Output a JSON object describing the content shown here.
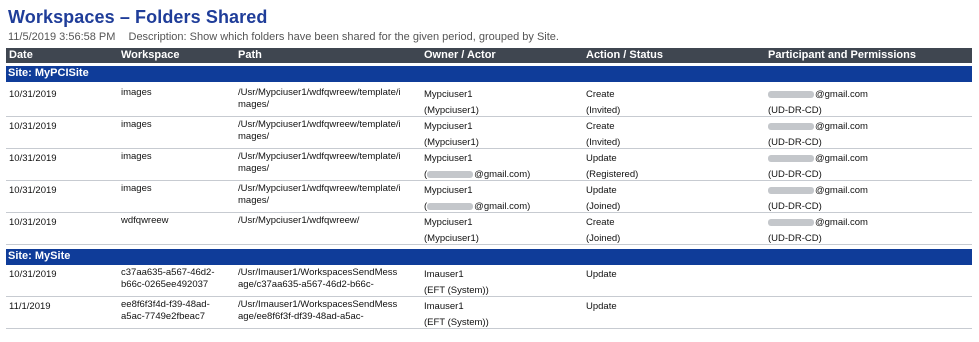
{
  "report": {
    "title": "Workspaces – Folders Shared",
    "timestamp": "11/5/2019 3:56:58 PM",
    "description": "Description: Show which folders have been shared for the given period, grouped  by Site."
  },
  "columns": [
    "Date",
    "Workspace",
    "Path",
    "Owner / Actor",
    "Action / Status",
    "Participant and Permissions"
  ],
  "groups": [
    {
      "site_label": "Site: MyPCISite",
      "rows": [
        {
          "date": "10/31/2019",
          "workspace": [
            "images"
          ],
          "path": [
            "/Usr/Mypciuser1/wdfqwreew/template/i",
            "mages/"
          ],
          "owner": [
            "Mypciuser1",
            "(Mypciuser1)"
          ],
          "action": [
            "Create",
            "(Invited)"
          ],
          "participant": [
            "@gmail.com",
            "(UD-DR-CD)"
          ]
        },
        {
          "date": "10/31/2019",
          "workspace": [
            "images"
          ],
          "path": [
            "/Usr/Mypciuser1/wdfqwreew/template/i",
            "mages/"
          ],
          "owner": [
            "Mypciuser1",
            "(Mypciuser1)"
          ],
          "action": [
            "Create",
            "(Invited)"
          ],
          "participant": [
            "@gmail.com",
            "(UD-DR-CD)"
          ]
        },
        {
          "date": "10/31/2019",
          "workspace": [
            "images"
          ],
          "path": [
            "/Usr/Mypciuser1/wdfqwreew/template/i",
            "mages/"
          ],
          "owner": [
            "Mypciuser1",
            "@gmail.com)"
          ],
          "action": [
            "Update",
            "(Registered)"
          ],
          "participant": [
            "@gmail.com",
            "(UD-DR-CD)"
          ]
        },
        {
          "date": "10/31/2019",
          "workspace": [
            "images"
          ],
          "path": [
            "/Usr/Mypciuser1/wdfqwreew/template/i",
            "mages/"
          ],
          "owner": [
            "Mypciuser1",
            "@gmail.com)"
          ],
          "action": [
            "Update",
            "(Joined)"
          ],
          "participant": [
            "@gmail.com",
            "(UD-DR-CD)"
          ]
        },
        {
          "date": "10/31/2019",
          "workspace": [
            "wdfqwreew"
          ],
          "path": [
            "/Usr/Mypciuser1/wdfqwreew/"
          ],
          "owner": [
            "Mypciuser1",
            "(Mypciuser1)"
          ],
          "action": [
            "Create",
            "(Joined)"
          ],
          "participant": [
            "@gmail.com",
            "(UD-DR-CD)"
          ]
        }
      ]
    },
    {
      "site_label": "Site: MySite",
      "rows": [
        {
          "date": "10/31/2019",
          "workspace": [
            "c37aa635-a567-46d2-",
            "b66c-0265ee492037"
          ],
          "path": [
            "/Usr/Imauser1/WorkspacesSendMess",
            "age/c37aa635-a567-46d2-b66c-"
          ],
          "owner": [
            "Imauser1",
            "(EFT (System))"
          ],
          "action": [
            "Update"
          ],
          "participant": []
        },
        {
          "date": "11/1/2019",
          "workspace": [
            "ee8f6f3f4d-f39-48ad-",
            "a5ac-7749e2fbeac7"
          ],
          "path": [
            "/Usr/Imauser1/WorkspacesSendMess",
            "age/ee8f6f3f-df39-48ad-a5ac-"
          ],
          "owner": [
            "Imauser1",
            "(EFT (System))"
          ],
          "action": [
            "Update"
          ],
          "participant": []
        }
      ]
    }
  ]
}
